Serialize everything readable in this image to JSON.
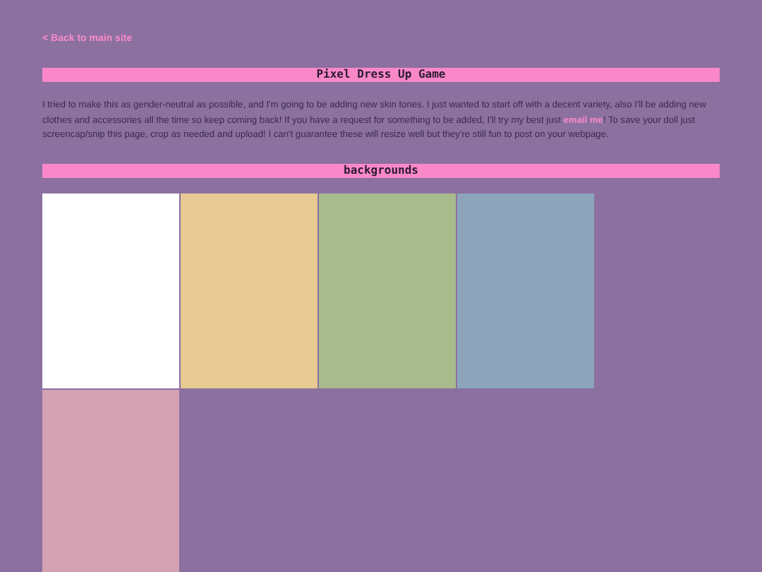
{
  "back_link": "< Back to main site",
  "title": "Pixel Dress Up Game",
  "intro": {
    "before": "I tried to make this as gender-neutral as possible, and I'm going to be adding new skin tones. I just wanted to start off with a decent variety, also I'll be adding new clothes and accessories all the time so keep coming back! If you have a request for something to be added, I'll try my best just",
    "link": "email me",
    "after": "! To save your doll just screencap/snip this page, crop as needed and upload! I can't guarantee these will resize well but they're still fun to post on your webpage."
  },
  "section": {
    "title": "backgrounds",
    "swatches": [
      {
        "color": "#ffffff"
      },
      {
        "color": "#e6c993"
      },
      {
        "color": "#a7bb8d"
      },
      {
        "color": "#8da5bb"
      },
      {
        "color": "#d4a1b3"
      }
    ]
  }
}
